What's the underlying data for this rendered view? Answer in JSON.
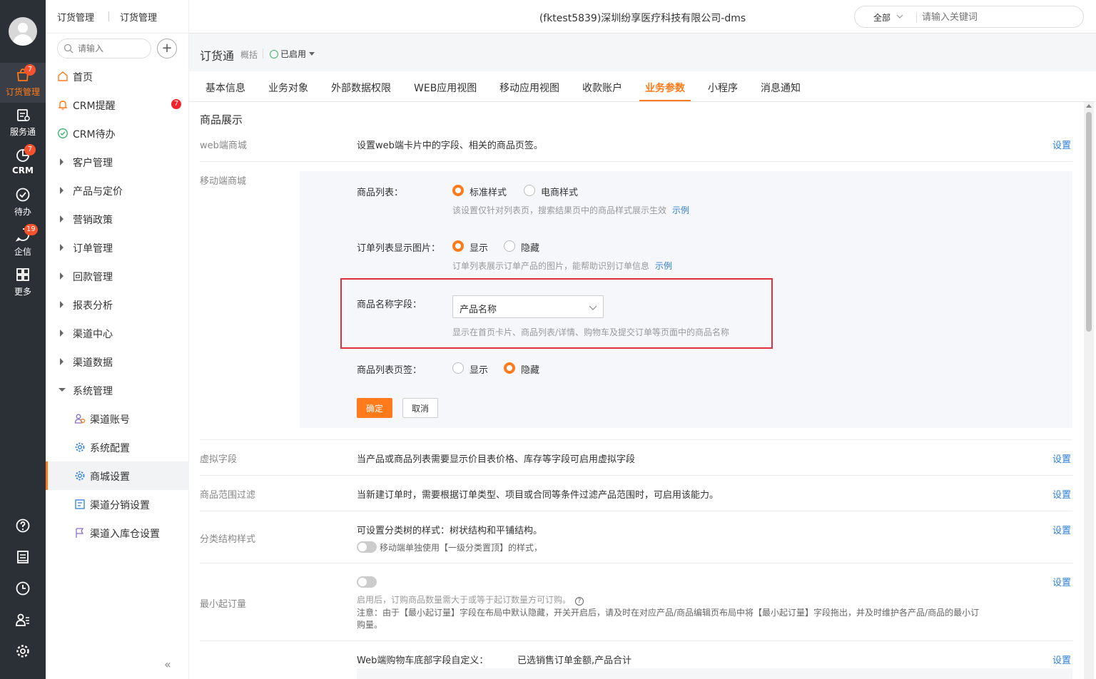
{
  "rail": {
    "items": [
      {
        "label": "订货管理",
        "badge": "7",
        "icon": "cart-icon"
      },
      {
        "label": "服务通",
        "badge": "",
        "icon": "service-icon"
      },
      {
        "label": "CRM",
        "badge": "7",
        "icon": "pie-chart-icon"
      },
      {
        "label": "待办",
        "badge": "",
        "icon": "check-circle-icon"
      },
      {
        "label": "企信",
        "badge": "19",
        "icon": "chat-icon"
      },
      {
        "label": "更多",
        "badge": "",
        "icon": "grid-icon"
      }
    ],
    "bottom_icons": [
      "help-icon",
      "notebook-icon",
      "clock-icon",
      "user-list-icon",
      "gear-icon"
    ],
    "accent": "#ff7a1a"
  },
  "breadcrumb": [
    "订货管理",
    "订货管理"
  ],
  "sidenav": {
    "search_placeholder": "请输入",
    "add_label": "+",
    "items": [
      {
        "label": "首页",
        "icon": "home-icon"
      },
      {
        "label": "CRM提醒",
        "icon": "bell-icon",
        "badge": "7"
      },
      {
        "label": "CRM待办",
        "icon": "check-circle-icon"
      },
      {
        "label": "客户管理"
      },
      {
        "label": "产品与定价"
      },
      {
        "label": "营销政策"
      },
      {
        "label": "订单管理"
      },
      {
        "label": "回款管理"
      },
      {
        "label": "报表分析"
      },
      {
        "label": "渠道中心"
      },
      {
        "label": "渠道数据"
      },
      {
        "label": "系统管理"
      }
    ],
    "sub_items": [
      {
        "label": "渠道账号",
        "icon": "users-icon"
      },
      {
        "label": "系统配置",
        "icon": "gear-icon"
      },
      {
        "label": "商城设置",
        "icon": "gear-icon"
      },
      {
        "label": "渠道分销设置",
        "icon": "distribution-icon"
      },
      {
        "label": "渠道入库仓设置",
        "icon": "flag-icon"
      }
    ],
    "collapse": "«"
  },
  "header": {
    "company": "(fktest5839)深圳纷享医疗科技有限公司-dms",
    "search_scope": "全部",
    "search_placeholder": "请输入关键词"
  },
  "app": {
    "title": "订货通",
    "overview": "概括",
    "status": "已启用"
  },
  "tabs": [
    "基本信息",
    "业务对象",
    "外部数据权限",
    "WEB应用视图",
    "移动应用视图",
    "收款账户",
    "业务参数",
    "小程序",
    "消息通知"
  ],
  "content": {
    "section_title": "商品展示",
    "set_label": "设置",
    "web_mall": {
      "label": "web端商城",
      "text": "设置web端卡片中的字段、相关的商品页签。"
    },
    "mobile_mall": {
      "label": "移动端商城",
      "product_list": {
        "label": "商品列表：",
        "opt1": "标准样式",
        "opt2": "电商样式",
        "hint": "该设置仅针对列表页，搜索结果页中的商品样式展示生效",
        "link": "示例"
      },
      "order_image": {
        "label": "订单列表显示图片：",
        "opt1": "显示",
        "opt2": "隐藏",
        "hint": "订单列表展示订单产品的图片，能帮助识别订单信息",
        "link": "示例"
      },
      "name_field": {
        "label": "商品名称字段：",
        "value": "产品名称",
        "hint": "显示在首页卡片、商品列表/详情、购物车及提交订单等页面中的商品名称"
      },
      "list_tab": {
        "label": "商品列表页签：",
        "opt1": "显示",
        "opt2": "隐藏"
      },
      "ok": "确定",
      "cancel": "取消"
    },
    "virtual_field": {
      "label": "虚拟字段",
      "text": "当产品或商品列表需要显示价目表价格、库存等字段可启用虚拟字段"
    },
    "range_filter": {
      "label": "商品范围过滤",
      "text": "当新建订单时，需要根据订单类型、项目或合同等条件过滤产品范围时，可启用该能力。"
    },
    "category_style": {
      "label": "分类结构样式",
      "text": "可设置分类树的样式：树状结构和平铺结构。",
      "toggle_text": "移动端单独使用【一级分类置顶】的样式，"
    },
    "min_order": {
      "label": "最小起订量",
      "desc": "启用后，订购商品数量需大于或等于起订数量方可订购。",
      "note1": "注意：由于【最小起订量】字段在布局中默认隐藏，开关开启后，请及时在对应产品/商品编辑页布局中将【最小起订量】字段拖出，并及时维护各产品/商品的最小订",
      "note2": "购量。"
    },
    "cart_footer": {
      "text": "Web端购物车底部字段自定义：",
      "value": "已选销售订单金额,产品合计"
    }
  }
}
